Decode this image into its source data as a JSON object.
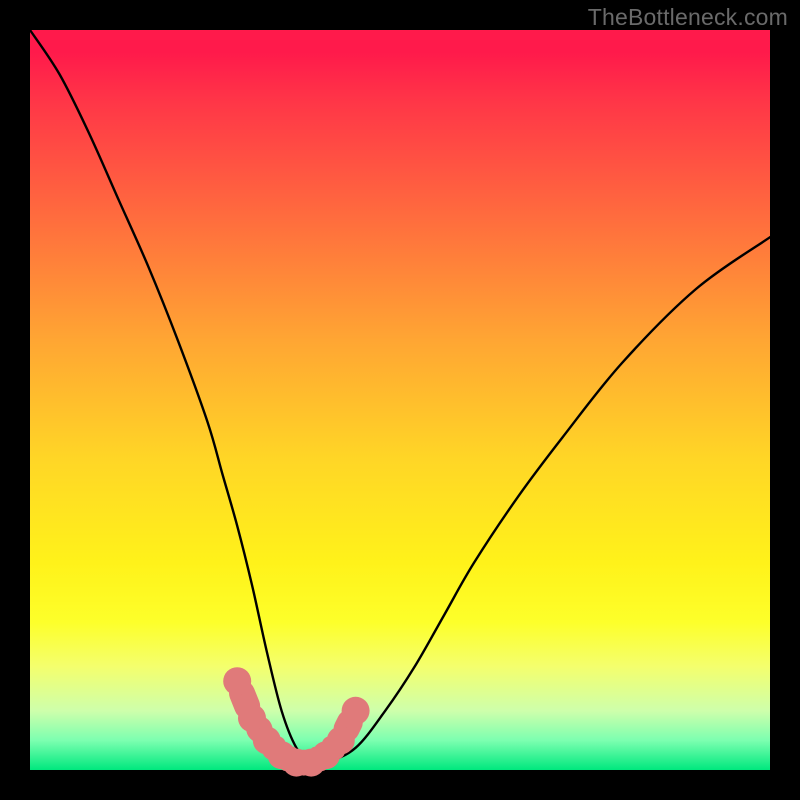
{
  "watermark": "TheBottleneck.com",
  "colors": {
    "background": "#000000",
    "curve": "#000000",
    "marker_fill": "#e07a7a",
    "marker_stroke": "#c46464"
  },
  "chart_data": {
    "type": "line",
    "title": "",
    "xlabel": "",
    "ylabel": "",
    "xlim": [
      0,
      100
    ],
    "ylim": [
      0,
      100
    ],
    "note": "Bottleneck-style V curve. X axis is an unlabeled horizontal parameter (0–100); Y axis is an unlabeled vertical bottleneck percentage (0 bottom → 100 top, inverted for plotting). Curve values are read from pixel positions.",
    "series": [
      {
        "name": "bottleneck-curve",
        "x": [
          0,
          4,
          8,
          12,
          16,
          20,
          24,
          26,
          28,
          30,
          32,
          34,
          36,
          38,
          40,
          44,
          48,
          52,
          56,
          60,
          66,
          72,
          80,
          90,
          100
        ],
        "y": [
          100,
          94,
          86,
          77,
          68,
          58,
          47,
          40,
          33,
          25,
          16,
          8,
          3,
          1,
          1,
          3,
          8,
          14,
          21,
          28,
          37,
          45,
          55,
          65,
          72
        ]
      }
    ],
    "markers": {
      "name": "highlighted-points",
      "x": [
        28,
        30,
        32,
        34,
        36,
        38,
        40,
        42,
        44
      ],
      "y": [
        12,
        7,
        4,
        2,
        1,
        1,
        2,
        4,
        8
      ]
    }
  }
}
